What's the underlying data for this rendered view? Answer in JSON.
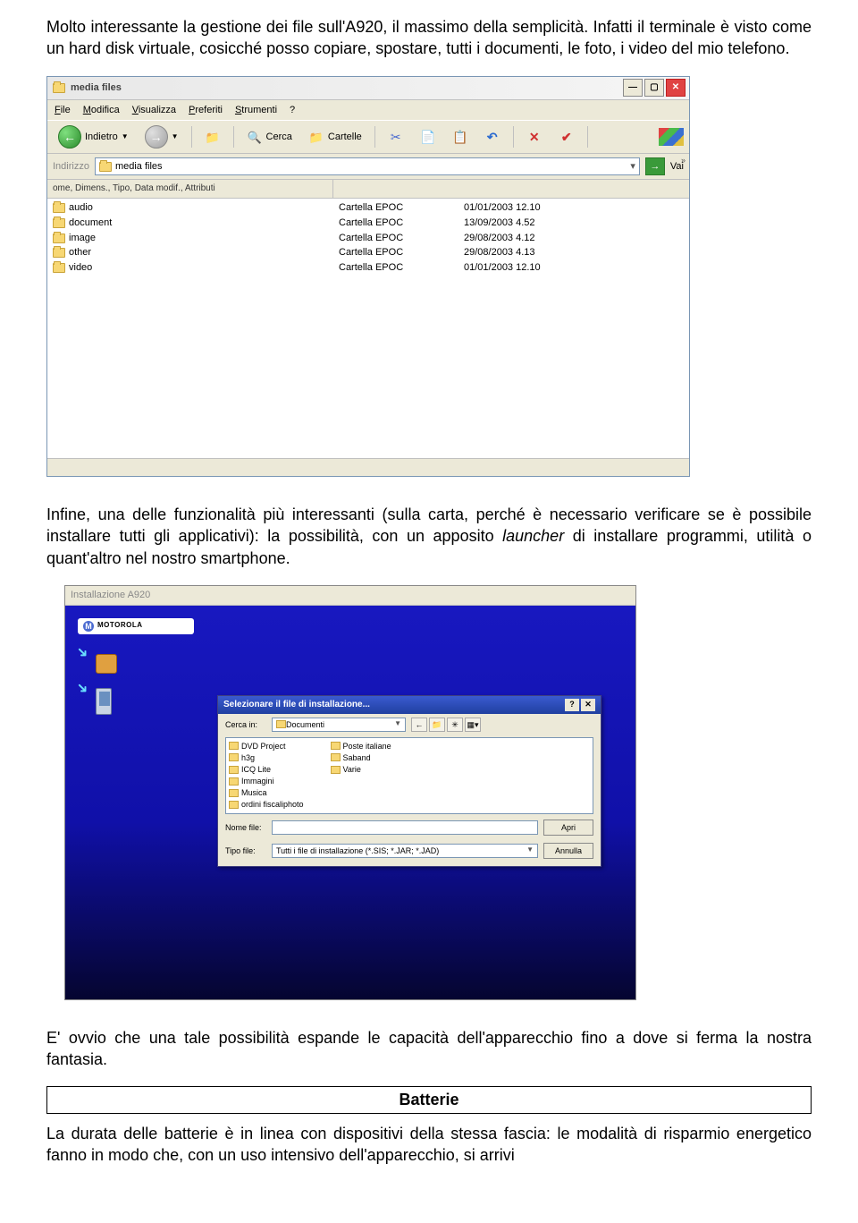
{
  "para1": "Molto interessante la gestione dei file sull'A920, il massimo della semplicità. Infatti il terminale è visto come un hard disk virtuale, cosicché posso copiare, spostare, tutti i documenti, le foto, i video del mio telefono.",
  "para2_a": "Infine, una delle funzionalità più interessanti (sulla carta, perché è necessario verificare se è possibile installare tutti gli applicativi): la possibilità, con un apposito ",
  "para2_i": "launcher",
  "para2_b": " di installare programmi, utilità o quant'altro nel nostro smartphone.",
  "para3": "E' ovvio che una tale possibilità espande le capacità dell'apparecchio fino a dove si ferma la nostra fantasia.",
  "section_title": "Batterie",
  "para4": "La durata delle batterie è in linea con dispositivi della stessa fascia: le modalità di risparmio energetico fanno in modo che, con un uso intensivo dell'apparecchio, si arrivi",
  "explorer": {
    "title": "media files",
    "menus": [
      "File",
      "Modifica",
      "Visualizza",
      "Preferiti",
      "Strumenti",
      "?"
    ],
    "back": "Indietro",
    "search": "Cerca",
    "folders": "Cartelle",
    "addr_label": "Indirizzo",
    "addr_value": "media files",
    "go": "Vai",
    "col_header": "ome, Dimens., Tipo, Data modif., Attributi",
    "more": "»",
    "rows": [
      {
        "name": "audio",
        "type": "Cartella EPOC",
        "date": "01/01/2003 12.10"
      },
      {
        "name": "document",
        "type": "Cartella EPOC",
        "date": "13/09/2003 4.52"
      },
      {
        "name": "image",
        "type": "Cartella EPOC",
        "date": "29/08/2003 4.12"
      },
      {
        "name": "other",
        "type": "Cartella EPOC",
        "date": "29/08/2003 4.13"
      },
      {
        "name": "video",
        "type": "Cartella EPOC",
        "date": "01/01/2003 12.10"
      }
    ]
  },
  "installer": {
    "app_title": "Installazione A920",
    "brand": "MOTOROLA",
    "dialog_title": "Selezionare il file di installazione...",
    "look_in_label": "Cerca in:",
    "look_in_value": "Documenti",
    "list_col1": [
      "DVD Project",
      "h3g",
      "ICQ Lite",
      "Immagini",
      "Musica",
      "ordini fiscaliphoto"
    ],
    "list_col2": [
      "Poste italiane",
      "Saband",
      "Varie"
    ],
    "name_label": "Nome file:",
    "type_label": "Tipo file:",
    "type_value": "Tutti i file di installazione (*.SIS; *.JAR; *.JAD)",
    "open": "Apri",
    "cancel": "Annulla"
  }
}
